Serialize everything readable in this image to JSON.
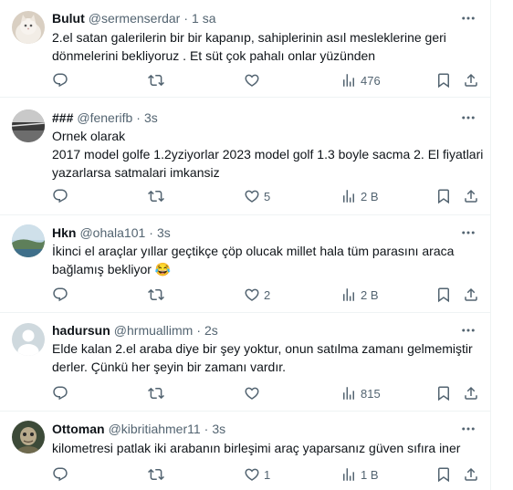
{
  "tweets": [
    {
      "name": "Bulut",
      "handle": "@sermenserdar",
      "separator": "·",
      "time": "1 sa",
      "avatar_icon": "cat-avatar-icon",
      "lines": [
        "2.el satan galerilerin bir bir kapanıp, sahiplerinin asıl mesleklerine geri",
        "dönmelerini bekliyoruz . Et süt çok pahalı onlar yüzünden"
      ],
      "likes": "",
      "views": "476"
    },
    {
      "name": "###",
      "handle": "@fenerifb",
      "separator": "·",
      "time": "3s",
      "avatar_icon": "train-photo-avatar-icon",
      "lines": [
        "Ornek olarak",
        "2017 model golfe 1.2yziyorlar 2023 model golf 1.3 boyle sacma 2. El fiyatlari",
        "yazarlarsa satmalari imkansiz"
      ],
      "likes": "5",
      "views": "2 B"
    },
    {
      "name": "Hkn",
      "handle": "@ohala101",
      "separator": "·",
      "time": "3s",
      "avatar_icon": "landscape-avatar-icon",
      "lines": [
        "İkinci el araçlar yıllar geçtikçe çöp olucak millet hala tüm parasını araca",
        "bağlamış bekliyor 😂"
      ],
      "likes": "2",
      "views": "2 B"
    },
    {
      "name": "hadursun",
      "handle": "@hrmuallimm",
      "separator": "·",
      "time": "2s",
      "avatar_icon": "default-profile-avatar-icon",
      "lines": [
        "Elde kalan 2.el araba diye bir şey yoktur, onun satılma zamanı gelmemiştir",
        "derler. Çünkü her şeyin bir zamanı vardır."
      ],
      "likes": "",
      "views": "815"
    },
    {
      "name": "Ottoman",
      "handle": "@kibritiahmer11",
      "separator": "·",
      "time": "3s",
      "avatar_icon": "portrait-avatar-icon",
      "lines": [
        "kilometresi patlak iki arabanın birleşimi araç yaparsanız güven sıfıra iner"
      ],
      "likes": "1",
      "views": "1 B"
    }
  ],
  "icons": {
    "reply": "reply-icon",
    "retweet": "retweet-icon",
    "like": "heart-icon",
    "views": "views-icon",
    "bookmark": "bookmark-icon",
    "share": "share-icon",
    "more": "more-icon"
  },
  "colors": {
    "text": "#0f1419",
    "secondary": "#536471",
    "border": "#eff3f4"
  }
}
